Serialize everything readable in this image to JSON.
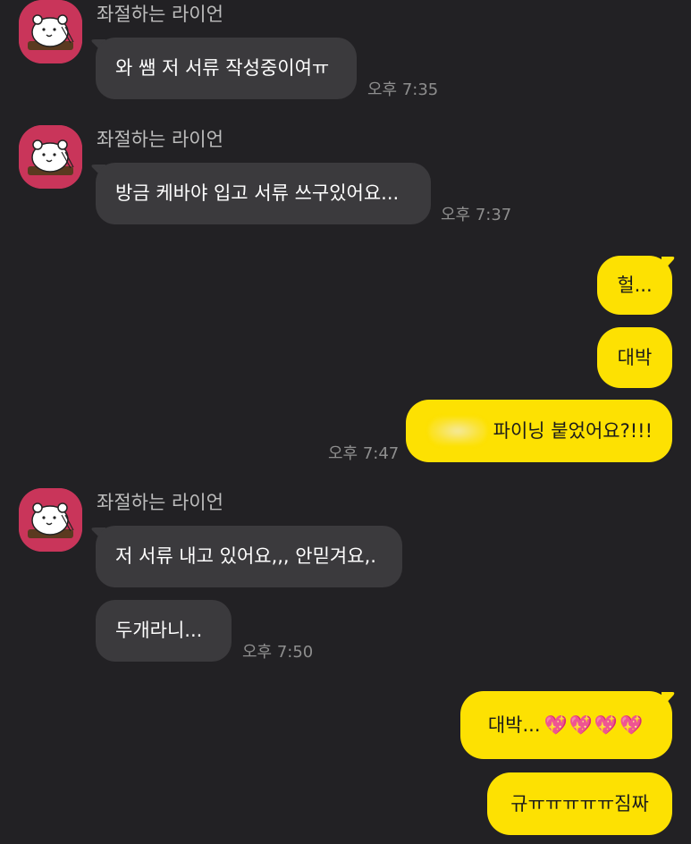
{
  "conversation": {
    "sender_name": "좌절하는 라이언",
    "messages": [
      {
        "text": "와 쌤 저 서류 작성중이여ㅠ",
        "time": "오후 7:35"
      },
      {
        "text": "방금 케바야 입고 서류 쓰구있어요...",
        "time": "오후 7:37"
      },
      {
        "text": "헐..."
      },
      {
        "text": "대박"
      },
      {
        "text": "파이닝 붙었어요?!!!",
        "time": "오후 7:47"
      },
      {
        "text": "저 서류 내고 있어요,,, 안믿겨요,."
      },
      {
        "text": "두개라니...",
        "time": "오후 7:50"
      },
      {
        "text": "대박...",
        "hearts": "💖💖💖💖"
      },
      {
        "text": "규ㅠㅠㅠㅠㅠ짐짜"
      }
    ]
  },
  "colors": {
    "background": "#222124",
    "incoming_bubble": "#3b3a3d",
    "outgoing_bubble": "#fde102",
    "avatar_bg": "#c9355a"
  },
  "icons": {
    "avatar": "ryan-character-avatar-icon"
  }
}
